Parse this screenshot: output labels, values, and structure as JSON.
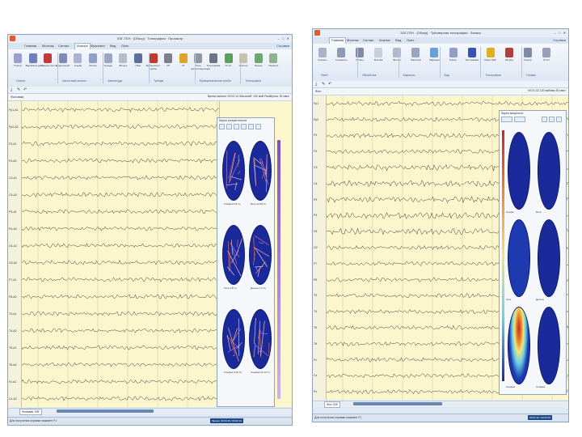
{
  "window1": {
    "title": "ЭЭГ-ГЕН · [Обзор] · Топография · Просмотр",
    "window_buttons": "– □ ✕",
    "menu": [
      "Главная",
      "Монтаж",
      "Сигнал",
      "Анализ",
      "Фрагмент",
      "Вид",
      "Окно"
    ],
    "active_menu_index": 3,
    "help": "Справка",
    "ribbon": [
      {
        "label": "Спектр",
        "color": "#9a9fd0"
      },
      {
        "label": "Вариабельность",
        "color": "#6d7fc0"
      },
      {
        "label": "Когерентность",
        "color": "#c03a3a"
      },
      {
        "label": "Корреляция",
        "color": "#7d8db8"
      },
      {
        "label": "Альфа",
        "color": "#a8b4d0"
      },
      {
        "label": "Ритмы",
        "color": "#8ea0cc"
      },
      {
        "label": "Тренды",
        "color": "#9aa6c4"
      },
      {
        "label": "Фильтр",
        "color": "#b8bcc8"
      },
      {
        "label": "Пики",
        "color": "#5d6f9a"
      },
      {
        "label": "Функционал. пробы",
        "color": "#c0392b"
      },
      {
        "label": "СП",
        "color": "#7a7f8c"
      },
      {
        "label": "ОГ",
        "color": "#e0a428"
      },
      {
        "label": "Ритм. фотостимуляция",
        "color": "#9098a8"
      },
      {
        "label": "Топограмма",
        "color": "#6a7585"
      },
      {
        "label": "Отчет",
        "color": "#5aa05a"
      },
      {
        "label": "Экспорт",
        "color": "#c7c0b0"
      },
      {
        "label": "Печать",
        "color": "#6fa86f"
      },
      {
        "label": "Перенос",
        "color": "#8fb28f"
      }
    ],
    "ribbon_groups": [
      "Спектр",
      "Частотный анализ",
      "Амплитуда",
      "Тренды",
      "Функциональные пробы",
      "Топография"
    ],
    "toolstrip": [
      "⤓",
      "✎",
      "↶"
    ],
    "header_left": "Фоновая",
    "header_right": "Время записи: 00:02:14   Масштаб: 100 мкВ   Развёртка: 30 мм/с",
    "channels": [
      "Fp1-A1",
      "Fp2-A2",
      "F3-A1",
      "F4-A2",
      "C3-A1",
      "C4-A2",
      "P3-A1",
      "P4-A2",
      "O1-A1",
      "O2-A2",
      "F7-A1",
      "F8-A2",
      "T3-A1",
      "T4-A2",
      "T5-A1",
      "T6-A2",
      "Fz-A1",
      "Cz-A2"
    ],
    "panel": {
      "title": "Карты когерентности",
      "heads": [
        {
          "label": "Альфа 8-13 Гц"
        },
        {
          "label": "Бета 13-25 Гц"
        },
        {
          "label": "Тета 4-8 Гц"
        },
        {
          "label": "Дельта 1-4 Гц"
        },
        {
          "label": "Альфа1 8-10 Гц"
        },
        {
          "label": "Альфа2 10-13 Гц"
        }
      ]
    },
    "tab": "Фоновая ЭЭГ",
    "status_left": "Для получения справки нажмите F1",
    "status_right": "Время: 00:00:45 / 00:02:14"
  },
  "window2": {
    "title": "ЭЭГ-ГЕН · [Обзор] · Трёхмерная топография · Запись",
    "window_buttons": "– □ ✕",
    "menu": [
      "Главная",
      "Монтаж",
      "Сигнал",
      "Анализ",
      "Вид",
      "Окно"
    ],
    "active_menu_index": 0,
    "help": "Справка",
    "ribbon": [
      {
        "label": "Открыть",
        "color": "#a7b3c8"
      },
      {
        "label": "Сохранить",
        "color": "#8e99b3"
      },
      {
        "label": "Печать",
        "color": "#7f8aa8"
      },
      {
        "label": "Монтаж",
        "color": "#c9cfdc"
      },
      {
        "label": "Фильтр",
        "color": "#b0b9cc"
      },
      {
        "label": "Масштаб",
        "color": "#9aa5be"
      },
      {
        "label": "Маркеры",
        "color": "#6aa0d8"
      },
      {
        "label": "Синхр.",
        "color": "#8fa0c4"
      },
      {
        "label": "Топограмма",
        "color": "#3a4fb8"
      },
      {
        "label": "Карта ЭЭГ",
        "color": "#e0b020"
      },
      {
        "label": "3D вид",
        "color": "#b04040"
      },
      {
        "label": "Спектр",
        "color": "#7e8aa8"
      },
      {
        "label": "Отчет",
        "color": "#9aa0b4"
      }
    ],
    "ribbon_groups": [
      "Файл",
      "Обработка",
      "Маркеры",
      "Вид",
      "Топография",
      "Сервис"
    ],
    "toolstrip": [
      "⤓",
      "✎",
      "↶"
    ],
    "header_left": "Фон",
    "header_right": "00:01:32   100 мкВ/мм   30 мм/с",
    "channels": [
      "Fp1",
      "Fp2",
      "F3",
      "F4",
      "C3",
      "C4",
      "P3",
      "P4",
      "O1",
      "O2",
      "F7",
      "F8",
      "T3",
      "T4",
      "T5",
      "T6",
      "Fz",
      "Cz",
      "Pz"
    ],
    "panel": {
      "title": "Карты мощности",
      "heads": [
        {
          "label": "Альфа",
          "fill": "#1b2a9a"
        },
        {
          "label": "Бета",
          "fill": "#1b2a9a"
        },
        {
          "label": "Тета",
          "fill": "#1d3ab0"
        },
        {
          "label": "Дельта",
          "fill": "#1b2a9a"
        },
        {
          "label": "Альфа1",
          "fill": "#d64a10"
        },
        {
          "label": "Альфа2",
          "fill": "#1b2a9a"
        }
      ]
    },
    "tab": "Фон ЭЭГ",
    "status_left": "Для получения справки нажмите F1",
    "status_right": "00:01:32 / 00:03:10"
  }
}
